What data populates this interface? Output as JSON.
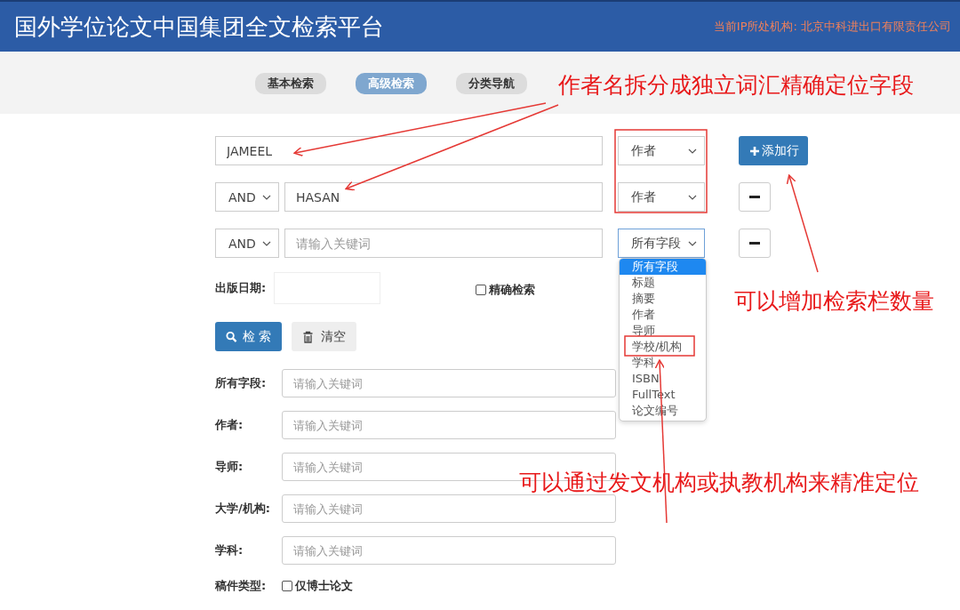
{
  "header": {
    "title": "国外学位论文中国集团全文检索平台",
    "ip_info": "当前IP所处机构: 北京中科进出口有限责任公司"
  },
  "tabs": [
    {
      "label": "基本检索",
      "selected": false
    },
    {
      "label": "高级检索",
      "selected": true
    },
    {
      "label": "分类导航",
      "selected": false
    }
  ],
  "query_rows": [
    {
      "value": "JAMEEL",
      "field": "作者",
      "action": {
        "kind": "add",
        "label": "添加行"
      }
    },
    {
      "operator": "AND",
      "value": "HASAN",
      "field": "作者",
      "action": {
        "kind": "remove"
      }
    },
    {
      "operator": "AND",
      "placeholder": "请输入关键词",
      "field": "所有字段",
      "focused": true,
      "action": {
        "kind": "remove"
      }
    }
  ],
  "date": {
    "label": "出版日期:"
  },
  "exact": {
    "label": "精确检索",
    "checked": false
  },
  "buttons": {
    "search": "检 索",
    "clear": "清空"
  },
  "fields": [
    {
      "label": "所有字段:",
      "placeholder": "请输入关键词"
    },
    {
      "label": "作者:",
      "placeholder": "请输入关键词"
    },
    {
      "label": "导师:",
      "placeholder": "请输入关键词"
    },
    {
      "label": "大学/机构:",
      "placeholder": "请输入关键词"
    },
    {
      "label": "学科:",
      "placeholder": "请输入关键词"
    }
  ],
  "doc_type": {
    "label": "稿件类型:",
    "option": {
      "label": "仅博士论文",
      "checked": false
    }
  },
  "dropdown": {
    "options": [
      {
        "label": "所有字段",
        "selected": true
      },
      {
        "label": "标题",
        "selected": false
      },
      {
        "label": "摘要",
        "selected": false
      },
      {
        "label": "作者",
        "selected": false
      },
      {
        "label": "导师",
        "selected": false
      },
      {
        "label": "学校/机构",
        "selected": false
      },
      {
        "label": "学科",
        "selected": false
      },
      {
        "label": "ISBN",
        "selected": false
      },
      {
        "label": "FullText",
        "selected": false
      },
      {
        "label": "论文编号",
        "selected": false
      }
    ]
  },
  "annotations": [
    "作者名拆分成独立词汇精确定位字段",
    "可以增加检索栏数量",
    "可以通过发文机构或执教机构来精准定位"
  ]
}
